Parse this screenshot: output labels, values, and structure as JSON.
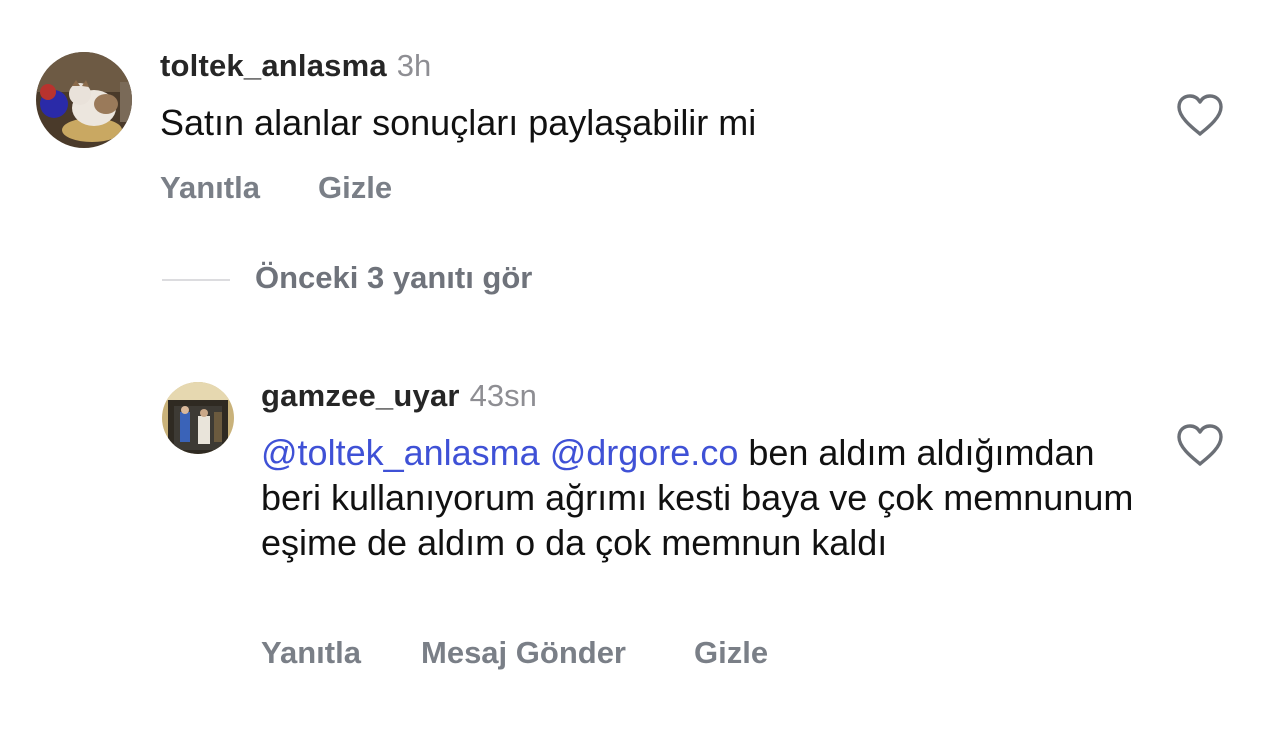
{
  "comments": [
    {
      "username": "toltek_anlasma",
      "time": "3h",
      "text": "Satın alanlar sonuçları paylaşabilir mi",
      "actions": [
        "Yanıtla",
        "Gizle"
      ]
    },
    {
      "username": "gamzee_uyar",
      "time": "43sn",
      "mentions": [
        "@toltek_anlasma",
        "@drgore.co"
      ],
      "text_after_mentions": " ben aldım aldığımdan beri kullanıyorum ağrımı kesti baya ve çok memnunum eşime de aldım o da çok memnun kaldı",
      "actions": [
        "Yanıtla",
        "Mesaj Gönder",
        "Gizle"
      ]
    }
  ],
  "view_previous_replies": "Önceki 3 yanıtı gör",
  "icons": {
    "like": "heart-outline-icon"
  },
  "colors": {
    "mention": "#3f51d6",
    "secondary_text": "#8e8e93",
    "action_text": "#7a7f87"
  }
}
